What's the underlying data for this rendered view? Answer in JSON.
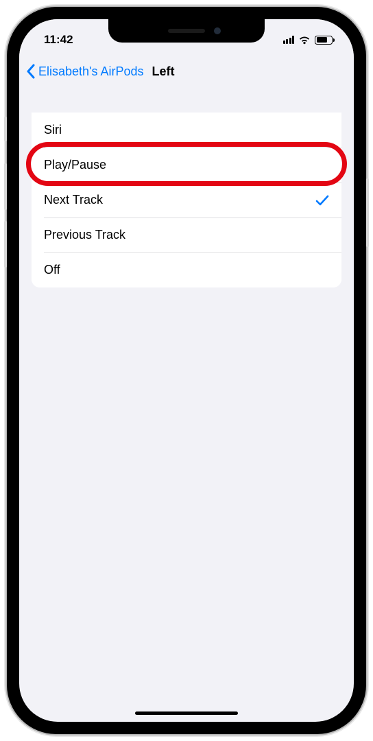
{
  "status": {
    "time": "11:42"
  },
  "nav": {
    "back_label": "Elisabeth's AirPods",
    "title": "Left"
  },
  "options": [
    {
      "label": "Siri",
      "selected": false,
      "highlighted": false
    },
    {
      "label": "Play/Pause",
      "selected": false,
      "highlighted": true
    },
    {
      "label": "Next Track",
      "selected": true,
      "highlighted": false
    },
    {
      "label": "Previous Track",
      "selected": false,
      "highlighted": false
    },
    {
      "label": "Off",
      "selected": false,
      "highlighted": false
    }
  ]
}
